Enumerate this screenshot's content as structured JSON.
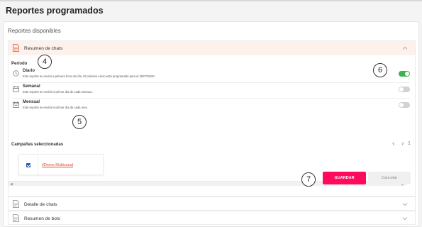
{
  "page": {
    "title": "Reportes programados"
  },
  "panel": {
    "title": "Reportes disponibles"
  },
  "accordions": [
    {
      "label": "Resumen de chats",
      "expanded": true
    },
    {
      "label": "Detalle de chats",
      "expanded": false
    },
    {
      "label": "Resumen de bots",
      "expanded": false
    }
  ],
  "period": {
    "label": "Período",
    "options": [
      {
        "name": "Diario",
        "description": "Este reporte se envirá a primera hora del día. El próximo envío está programado para el 28/07/2020.",
        "enabled": true
      },
      {
        "name": "Semanal",
        "description": "Este reporte se envirá el primer día de cada semana.",
        "enabled": false
      },
      {
        "name": "Mensual",
        "description": "Este reporte se envirá el primer día de cada mes.",
        "enabled": false
      }
    ]
  },
  "campaigns": {
    "label": "Campañas seleccionadas",
    "items": [
      {
        "name": "#Demo Multicanal",
        "checked": true
      }
    ],
    "page_number": "1"
  },
  "actions": {
    "save_label": "GUARDAR",
    "cancel_label": "Cancelar"
  },
  "annotations": {
    "period_step": "4",
    "campaigns_step": "5",
    "toggle_step": "6",
    "save_step": "7"
  },
  "colors": {
    "accent": "#e04b29",
    "save_button": "#ff0a5f",
    "toggle_on": "#39b54a",
    "active_header_bg": "#fdf1ec"
  },
  "icons": {
    "report": "document-icon",
    "daily": "clock-icon",
    "weekly": "calendar-icon",
    "monthly": "calendar-icon",
    "collapse": "chevron-up-icon",
    "expand": "chevron-down-icon"
  }
}
